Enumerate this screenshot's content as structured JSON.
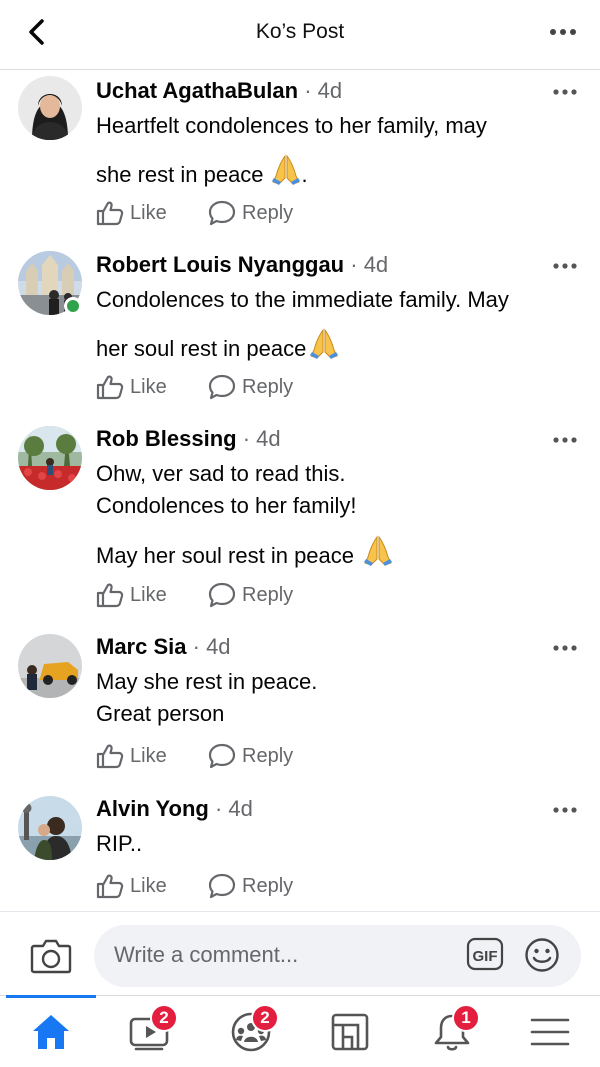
{
  "header": {
    "title": "Ko’s Post"
  },
  "comments": [
    {
      "name": "Uchat AgathaBulan",
      "time": "· 4d",
      "lines": [
        "Heartfelt condolences to her family, may",
        "she rest in peace",
        "."
      ],
      "like": "Like",
      "reply": "Reply"
    },
    {
      "name": "Robert Louis Nyanggau",
      "time": "· 4d",
      "lines": [
        "Condolences to the immediate family. May",
        "her soul rest in peace"
      ],
      "like": "Like",
      "reply": "Reply"
    },
    {
      "name": "Rob Blessing",
      "time": "· 4d",
      "lines": [
        "Ohw, ver sad to read this.",
        "Condolences to her family!",
        "May her soul rest in peace"
      ],
      "like": "Like",
      "reply": "Reply"
    },
    {
      "name": "Marc Sia",
      "time": "· 4d",
      "lines": [
        "May she rest in peace.",
        "Great person"
      ],
      "like": "Like",
      "reply": "Reply"
    },
    {
      "name": "Alvin Yong",
      "time": "· 4d",
      "lines": [
        "RIP.."
      ],
      "like": "Like",
      "reply": "Reply"
    }
  ],
  "composer": {
    "placeholder": "Write a comment...",
    "gif_label": "GIF"
  },
  "tabbar": {
    "video_badge": "2",
    "groups_badge": "2",
    "notifications_badge": "1"
  },
  "colors": {
    "accent": "#1877f2",
    "badge": "#e41e3f",
    "online": "#31a24c",
    "muted": "#65676b"
  }
}
